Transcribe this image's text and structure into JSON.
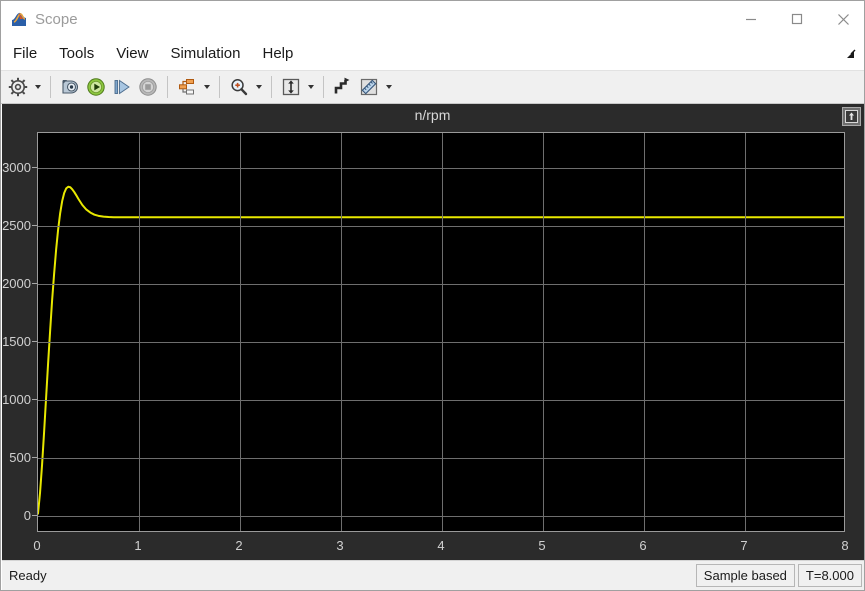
{
  "window": {
    "title": "Scope",
    "icon": "matlab-scope-icon",
    "controls": {
      "minimize": "minimize-icon",
      "maximize": "maximize-icon",
      "close": "close-icon"
    }
  },
  "menubar": {
    "items": [
      {
        "label": "File"
      },
      {
        "label": "Tools"
      },
      {
        "label": "View"
      },
      {
        "label": "Simulation"
      },
      {
        "label": "Help"
      }
    ],
    "undock_icon": "undock-arrow-icon"
  },
  "toolbar": {
    "groups": [
      {
        "buttons": [
          {
            "name": "configuration-properties-button",
            "icon": "gear-icon",
            "has_caret": true
          }
        ]
      },
      {
        "buttons": [
          {
            "name": "rewind-button",
            "icon": "rewind-icon",
            "has_caret": false
          },
          {
            "name": "run-button",
            "icon": "play-icon",
            "has_caret": false
          },
          {
            "name": "step-forward-button",
            "icon": "step-forward-icon",
            "has_caret": false
          },
          {
            "name": "stop-button",
            "icon": "stop-icon",
            "has_caret": false
          }
        ]
      },
      {
        "buttons": [
          {
            "name": "signal-selection-button",
            "icon": "signal-blocks-icon",
            "has_caret": true
          }
        ]
      },
      {
        "buttons": [
          {
            "name": "zoom-in-button",
            "icon": "zoom-magnifier-icon",
            "has_caret": true
          }
        ]
      },
      {
        "buttons": [
          {
            "name": "autoscale-button",
            "icon": "autoscale-icon",
            "has_caret": true
          }
        ]
      },
      {
        "buttons": [
          {
            "name": "style-button",
            "icon": "line-style-icon",
            "has_caret": false
          },
          {
            "name": "measurements-button",
            "icon": "ruler-icon",
            "has_caret": true
          }
        ]
      }
    ]
  },
  "scope": {
    "plot_title": "n/rpm",
    "maximize_axes_icon": "maximize-axes-icon",
    "colors": {
      "background": "#2b2b2b",
      "plot_background": "#000000",
      "grid": "#6e6e6e",
      "axis_text": "#d0d0d0",
      "trace": "#e8e800"
    }
  },
  "statusbar": {
    "status": "Ready",
    "sample_mode": "Sample based",
    "time": "T=8.000"
  },
  "chart_data": {
    "type": "line",
    "title": "n/rpm",
    "xlabel": "",
    "ylabel": "",
    "xlim": [
      0,
      8
    ],
    "ylim": [
      -150,
      3300
    ],
    "xticks": [
      0,
      1,
      2,
      3,
      4,
      5,
      6,
      7,
      8
    ],
    "yticks": [
      0,
      500,
      1000,
      1500,
      2000,
      2500,
      3000
    ],
    "grid": true,
    "legend": null,
    "series": [
      {
        "name": "n/rpm",
        "color": "#e8e800",
        "x": [
          0.0,
          0.02,
          0.04,
          0.06,
          0.08,
          0.1,
          0.12,
          0.14,
          0.16,
          0.18,
          0.2,
          0.22,
          0.24,
          0.26,
          0.28,
          0.3,
          0.32,
          0.34,
          0.36,
          0.38,
          0.4,
          0.44,
          0.48,
          0.52,
          0.56,
          0.6,
          0.65,
          0.7,
          0.75,
          0.8,
          0.9,
          1.0,
          1.2,
          1.5,
          2.0,
          2.5,
          3.0,
          4.0,
          5.0,
          6.0,
          7.0,
          8.0
        ],
        "y": [
          0,
          180,
          420,
          700,
          1000,
          1300,
          1580,
          1850,
          2080,
          2290,
          2465,
          2605,
          2710,
          2780,
          2820,
          2834,
          2830,
          2812,
          2788,
          2760,
          2730,
          2676,
          2636,
          2610,
          2592,
          2582,
          2575,
          2572,
          2570,
          2570,
          2570,
          2570,
          2570,
          2570,
          2570,
          2570,
          2570,
          2570,
          2570,
          2570,
          2570,
          2570
        ],
        "steady_state_value": 2570,
        "peak_value": 2834,
        "peak_time": 0.3
      }
    ]
  }
}
